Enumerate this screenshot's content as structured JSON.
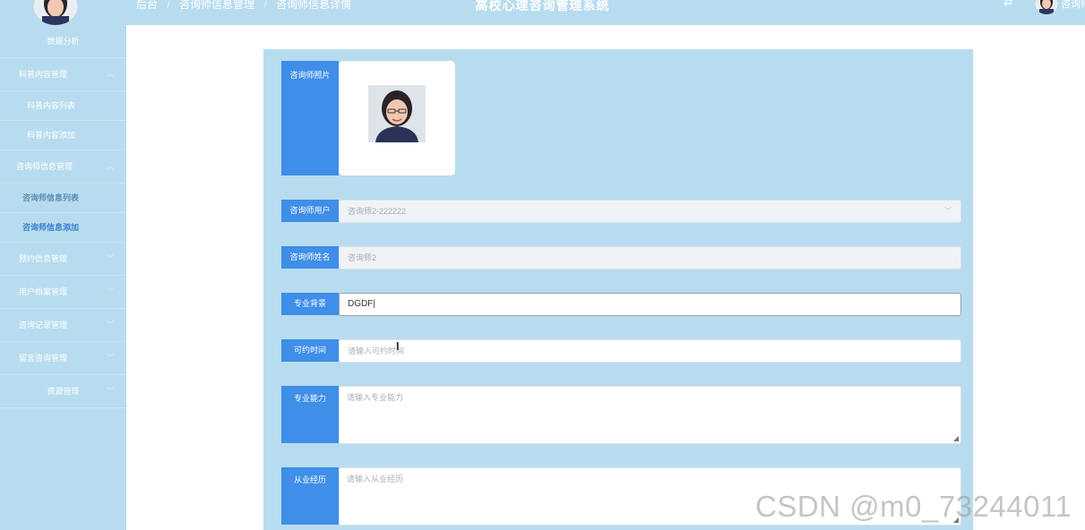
{
  "header": {
    "breadcrumb": [
      "后台",
      "咨询师信息管理",
      "咨询师信息详情"
    ],
    "breadcrumb_sep": "/",
    "title": "高校心理咨询管理系统",
    "user_name": "咨询师"
  },
  "sidebar": {
    "items": [
      {
        "label": "数据分析"
      },
      {
        "label": "科普内容管理"
      },
      {
        "label": "科普内容列表"
      },
      {
        "label": "科普内容添加"
      },
      {
        "label": "咨询师信息管理"
      },
      {
        "label": "咨询师信息列表"
      },
      {
        "label": "咨询师信息添加"
      },
      {
        "label": "预约信息管理"
      },
      {
        "label": "用户档案管理"
      },
      {
        "label": "咨询记录管理"
      },
      {
        "label": "留言咨询管理"
      },
      {
        "label": "资源管理"
      }
    ]
  },
  "form": {
    "photo_label": "咨询师照片",
    "user_label": "咨询师用户",
    "user_value": "咨询师2-222222",
    "name_label": "咨询师姓名",
    "name_value": "咨询师2",
    "background_label": "专业背景",
    "background_value": "DGDF",
    "time_label": "可约时间",
    "time_placeholder": "请输入可约时间",
    "ability_label": "专业能力",
    "ability_placeholder": "请输入专业能力",
    "experience_label": "从业经历",
    "experience_placeholder": "请输入从业经历"
  },
  "watermark": "CSDN @m0_73244011",
  "icons": {
    "chevron": "chevron-icon",
    "switch": "switch-icon",
    "text_cursor": "text-cursor-icon"
  },
  "colors": {
    "theme": "#b8dcef",
    "label_bg": "#3f8ee8",
    "active_text": "#3a7fd0"
  }
}
